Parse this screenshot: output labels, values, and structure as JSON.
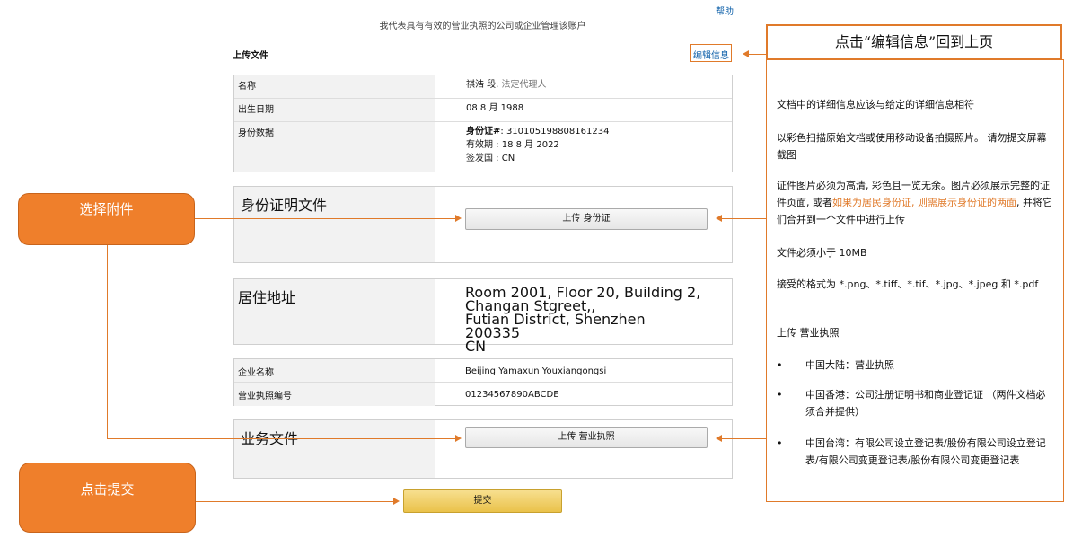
{
  "header": {
    "help_label": "帮助",
    "account_text": "我代表具有有效的营业执照的公司或企业管理该账户"
  },
  "section": {
    "title": "上传文件",
    "edit_label": "编辑信息"
  },
  "identity": {
    "name_label": "名称",
    "name_value": "祺浩 段",
    "name_role": ", 法定代理人",
    "dob_label": "出生日期",
    "dob_value": "08 8 月 1988",
    "id_label": "身份数据",
    "id_number_label": "身份证#",
    "id_number": ": 310105198808161234",
    "id_expiry": "有效期 : 18 8 月 2022",
    "id_country": "签发国 : CN"
  },
  "id_doc": {
    "label": "身份证明文件",
    "button": "上传 身份证"
  },
  "address": {
    "label": "居住地址",
    "line1": "Room 2001, Floor 20, Building 2, Changan Stgreet,,",
    "line2": "Futian District, Shenzhen",
    "line3": "200335",
    "line4": "CN"
  },
  "company": {
    "name_label": "企业名称",
    "name_value": "Beijing Yamaxun Youxiangongsi",
    "license_label": "营业执照编号",
    "license_value": "01234567890ABCDE"
  },
  "business_doc": {
    "label": "业务文件",
    "button": "上传 营业执照"
  },
  "submit_label": "提交",
  "callouts": {
    "select_attachment": "选择附件",
    "click_submit": "点击提交"
  },
  "notes": {
    "title": "点击“编辑信息”回到上页",
    "p1": "文档中的详细信息应该与给定的详细信息相符",
    "p2": "以彩色扫描原始文档或使用移动设备拍摄照片。 请勿提交屏幕截图",
    "p3_a": "证件图片必须为高清, 彩色且一览无余。图片必须展示完整的证件页面, 或者",
    "p3_highlight": "如果为居民身份证, 则需展示身份证的两面",
    "p3_b": ", 并将它们合并到一个文件中进行上传",
    "p4": "文件必须小于 10MB",
    "p5": "接受的格式为 *.png、*.tiff、*.tif、*.jpg、*.jpeg 和 *.pdf",
    "p6": "上传 营业执照",
    "b1": "中国大陆：营业执照",
    "b2": "中国香港：公司注册证明书和商业登记证 （两件文档必须合并提供）",
    "b3": "中国台湾：有限公司设立登记表/股份有限公司设立登记表/有限公司变更登记表/股份有限公司变更登记表"
  }
}
